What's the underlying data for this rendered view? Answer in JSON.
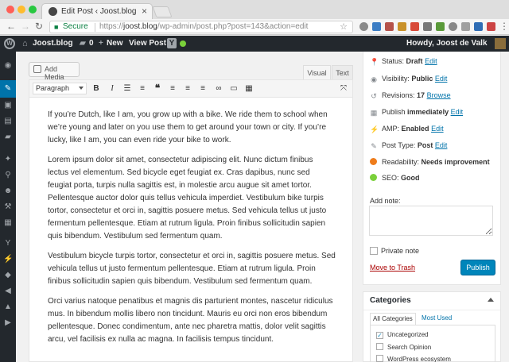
{
  "browser": {
    "tab_title": "Edit Post ‹ Joost.blog — WordPress",
    "tab_close": "×",
    "secure_label": "Secure",
    "url_scheme": "https://",
    "url_host": "joost.blog",
    "url_path": "/wp-admin/post.php?post=143&action=edit",
    "traffic_colors": [
      "#ff5f57",
      "#febc2e",
      "#28c840"
    ]
  },
  "admin_bar": {
    "site_name": "Joost.blog",
    "comments_count": "0",
    "new_label": "New",
    "view_post_label": "View Post",
    "howdy": "Howdy, Joost de Valk"
  },
  "editor": {
    "add_media_label": "Add Media",
    "tab_visual": "Visual",
    "tab_text": "Text",
    "format_select": "Paragraph",
    "paragraphs": [
      "If you’re Dutch, like I am, you grow up with a bike. We ride them to school when we’re young and later on you use them to get around your town or city. If you’re lucky, like I am, you can even ride your bike to work.",
      "Lorem ipsum dolor sit amet, consectetur adipiscing elit. Nunc dictum finibus lectus vel elementum. Sed bicycle eget feugiat ex. Cras dapibus, nunc sed feugiat porta, turpis nulla sagittis est, in molestie arcu augue sit amet tortor. Pellentesque auctor dolor quis tellus vehicula imperdiet. Vestibulum bike turpis tortor, consectetur et orci in, sagittis posuere metus. Sed vehicula tellus ut justo fermentum pellentesque. Etiam at rutrum ligula. Proin finibus sollicitudin sapien quis bibendum. Vestibulum sed fermentum quam.",
      "Vestibulum bicycle turpis tortor, consectetur et orci in, sagittis posuere metus. Sed vehicula tellus ut justo fermentum pellentesque. Etiam at rutrum ligula. Proin finibus sollicitudin sapien quis bibendum. Vestibulum sed fermentum quam.",
      "Orci varius natoque penatibus et magnis dis parturient montes, nascetur ridiculus mus. In bibendum mollis libero non tincidunt. Mauris eu orci non eros bibendum pellentesque. Donec condimentum, ante nec pharetra mattis, dolor velit sagittis arcu, vel facilisis ex nulla ac magna. In facilisis tempus tincidunt."
    ]
  },
  "publish": {
    "status_label": "Status:",
    "status_value": "Draft",
    "visibility_label": "Visibility:",
    "visibility_value": "Public",
    "revisions_label": "Revisions:",
    "revisions_value": "17",
    "browse_link": "Browse",
    "publish_label": "Publish",
    "publish_value": "immediately",
    "amp_label": "AMP:",
    "amp_value": "Enabled",
    "post_type_label": "Post Type:",
    "post_type_value": "Post",
    "readability_label": "Readability:",
    "readability_value": "Needs improvement",
    "seo_label": "SEO:",
    "seo_value": "Good",
    "edit_link": "Edit",
    "add_note_label": "Add note:",
    "private_note_label": "Private note",
    "trash_link": "Move to Trash",
    "publish_button": "Publish",
    "accent_color": "#0085ba"
  },
  "categories": {
    "title": "Categories",
    "tab_all": "All Categories",
    "tab_used": "Most Used",
    "items": [
      {
        "label": "Uncategorized",
        "checked": true
      },
      {
        "label": "Search Opinion",
        "checked": false
      },
      {
        "label": "WordPress ecosystem",
        "checked": false
      }
    ]
  }
}
